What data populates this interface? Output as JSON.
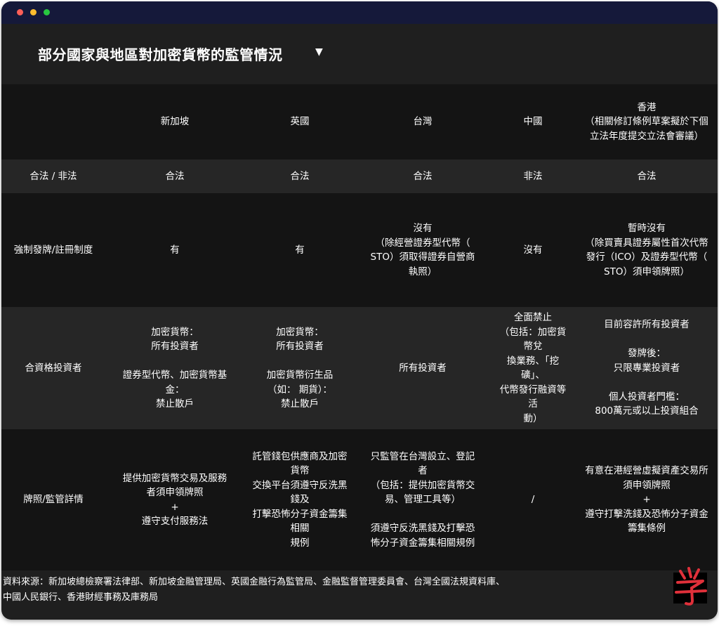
{
  "title": "部分國家與地區對加密貨幣的監管情況",
  "columns": [
    "",
    "新加坡",
    "英國",
    "台灣",
    "中國",
    "香港\n（相關修訂條例草案擬於下個\n立法年度提交立法會審議）"
  ],
  "rows": [
    {
      "label": "合法 / 非法",
      "cells": [
        "合法",
        "合法",
        "合法",
        "非法",
        "合法"
      ]
    },
    {
      "label": "強制發牌/註冊制度",
      "cells": [
        "有",
        "有",
        "沒有\n（除經營證券型代幣（\nSTO）須取得證券自營商\n執照）",
        "沒有",
        "暫時沒有\n（除買賣具證券屬性首次代幣\n發行（ICO）及證券型代幣（\nSTO）須申領牌照）"
      ]
    },
    {
      "label": "合資格投資者",
      "cells": [
        "加密貨幣：\n所有投資者\n\n證券型代幣、加密貨幣基\n金：\n禁止散戶",
        "加密貨幣：\n所有投資者\n\n加密貨幣衍生品\n（如： 期貨）：\n禁止散戶",
        "所有投資者",
        "全面禁止\n（包括：加密貨幣兌\n換業務、「挖礦」、\n代幣發行融資等活\n動）",
        "目前容許所有投資者\n\n發牌後：\n只限專業投資者\n\n個人投資者門檻：\n800萬元或以上投資組合"
      ]
    },
    {
      "label": "牌照/監管詳情",
      "cells": [
        "提供加密貨幣交易及服務\n者須申領牌照\n+\n遵守支付服務法",
        "託管錢包供應商及加密貨幣\n交換平台須遵守反洗黑錢及\n打擊恐怖分子資金籌集相關\n規例",
        "只監管在台灣設立、登記\n者\n（包括：提供加密貨幣交\n易、管理工具等）\n\n須遵守反洗黑錢及打擊恐\n怖分子資金籌集相關規例",
        "/",
        "有意在港經營虛擬資產交易所\n須申領牌照\n+\n遵守打擊洗錢及恐怖分子資金\n籌集條例"
      ]
    }
  ],
  "source": "資料來源：新加坡總檢察署法律部、新加坡金融管理局、英國金融行為監管局、金融監督管理委員會、台灣全國法規資料庫、\n                 中國人民銀行、香港財經事務及庫務局"
}
